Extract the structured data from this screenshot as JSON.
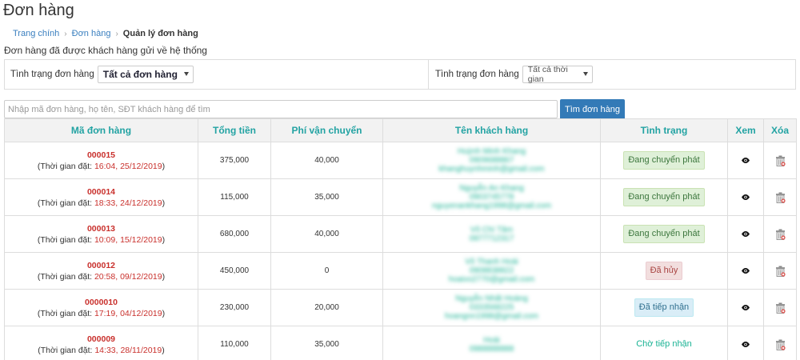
{
  "header": {
    "title": "Đơn hàng"
  },
  "breadcrumb": {
    "home": "Trang chính",
    "orders": "Đơn hàng",
    "current": "Quản lý đơn hàng"
  },
  "description": "Đơn hàng đã được khách hàng gửi về hệ thống",
  "filters": {
    "status_label": "Tình trạng đơn hàng",
    "status_value": "Tất cả đơn hàng",
    "time_label": "Tình trạng đơn hàng",
    "time_value": "Tất cả thời gian"
  },
  "search": {
    "placeholder": "Nhập mã đơn hàng, họ tên, SĐT khách hàng để tìm",
    "button": "Tìm đơn hàng"
  },
  "table": {
    "columns": [
      "Mã đơn hàng",
      "Tổng tiền",
      "Phí vận chuyển",
      "Tên khách hàng",
      "Tình trạng",
      "Xem",
      "Xóa"
    ],
    "time_prefix": "(Thời gian đặt: ",
    "time_suffix": ")",
    "rows": [
      {
        "code": "000015",
        "time": "16:04, 25/12/2019",
        "total": "375,000",
        "shipping": "40,000",
        "customer": [
          "Huỳnh Minh Khang",
          "0909688867",
          "khanghuynhminh@gmail.com"
        ],
        "status": "Đang chuyển phát",
        "status_type": "ship"
      },
      {
        "code": "000014",
        "time": "18:33, 24/12/2019",
        "total": "115,000",
        "shipping": "35,000",
        "customer": [
          "Nguyễn An Khang",
          "0903745778",
          "nguyenankhang1998@gmail.com"
        ],
        "status": "Đang chuyển phát",
        "status_type": "ship"
      },
      {
        "code": "000013",
        "time": "10:09, 15/12/2019",
        "total": "680,000",
        "shipping": "40,000",
        "customer": [
          "Võ Chí Tâm",
          "0977712317"
        ],
        "status": "Đang chuyển phát",
        "status_type": "ship"
      },
      {
        "code": "000012",
        "time": "20:58, 09/12/2019",
        "total": "450,000",
        "shipping": "0",
        "customer": [
          "Võ Thanh Hoài",
          "0908838822",
          "hoaivo2770@gmail.com"
        ],
        "status": "Đã hủy",
        "status_type": "cancel"
      },
      {
        "code": "0000010",
        "time": "17:19, 04/12/2019",
        "total": "230,000",
        "shipping": "20,000",
        "customer": [
          "Nguyễn Nhất Hoàng",
          "0333568225",
          "hoangnn1998@gmail.com"
        ],
        "status": "Đã tiếp nhận",
        "status_type": "recv"
      },
      {
        "code": "000009",
        "time": "14:33, 28/11/2019",
        "total": "110,000",
        "shipping": "35,000",
        "customer": [
          "Hoài",
          "0988888888"
        ],
        "status": "Chờ tiếp nhận",
        "status_type": "wait"
      }
    ]
  },
  "icons": {
    "view": "eye-icon",
    "delete": "trash-icon"
  },
  "colors": {
    "accent": "#23a3a3",
    "order_code": "#c9302c",
    "primary_button": "#337ab7"
  }
}
